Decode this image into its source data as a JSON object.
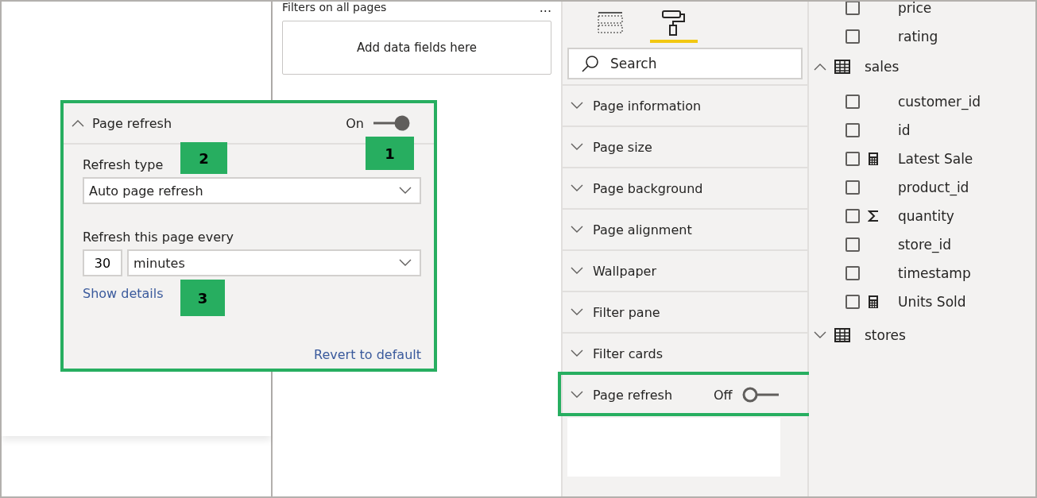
{
  "filters_pane": {
    "title": "Filters on all pages",
    "more": "...",
    "drop_zone": "Add data fields here"
  },
  "format_pane": {
    "tabs": [
      {
        "kind": "fields",
        "selected": false
      },
      {
        "kind": "format",
        "selected": true
      }
    ],
    "search": {
      "placeholder": "Search"
    },
    "sections": [
      {
        "label": "Page information",
        "expanded": false,
        "highlighted": false
      },
      {
        "label": "Page size",
        "expanded": false,
        "highlighted": false
      },
      {
        "label": "Page background",
        "expanded": false,
        "highlighted": false
      },
      {
        "label": "Page alignment",
        "expanded": false,
        "highlighted": false
      },
      {
        "label": "Wallpaper",
        "expanded": false,
        "highlighted": false
      },
      {
        "label": "Filter pane",
        "expanded": false,
        "highlighted": false
      },
      {
        "label": "Filter cards",
        "expanded": false,
        "highlighted": false
      },
      {
        "label": "Page refresh",
        "expanded": false,
        "highlighted": true,
        "toggle": {
          "label": "Off",
          "on": false
        }
      }
    ]
  },
  "fields_pane": {
    "fields": [
      {
        "name": "price",
        "checked": false
      },
      {
        "name": "rating",
        "checked": false
      }
    ],
    "tables": [
      {
        "name": "sales",
        "expanded": true,
        "children": [
          {
            "name": "customer_id",
            "checked": false
          },
          {
            "name": "id",
            "checked": false
          },
          {
            "name": "Latest Sale",
            "kind": "measure",
            "checked": false
          },
          {
            "name": "product_id",
            "checked": false
          },
          {
            "name": "quantity",
            "kind": "sum",
            "checked": false
          },
          {
            "name": "store_id",
            "checked": false
          },
          {
            "name": "timestamp",
            "checked": false
          },
          {
            "name": "Units Sold",
            "kind": "measure",
            "checked": false
          }
        ]
      },
      {
        "name": "stores",
        "expanded": false
      }
    ]
  },
  "popup": {
    "title": "Page refresh",
    "expanded": true,
    "toggle": {
      "label": "On",
      "on": true
    },
    "refresh_type_label": "Refresh type",
    "refresh_type": "Auto page refresh",
    "interval_label": "Refresh this page every",
    "interval_value": "30",
    "interval_unit": "minutes",
    "details_link": "Show details",
    "revert_link": "Revert to default"
  },
  "callouts": [
    "1",
    "2",
    "3"
  ]
}
